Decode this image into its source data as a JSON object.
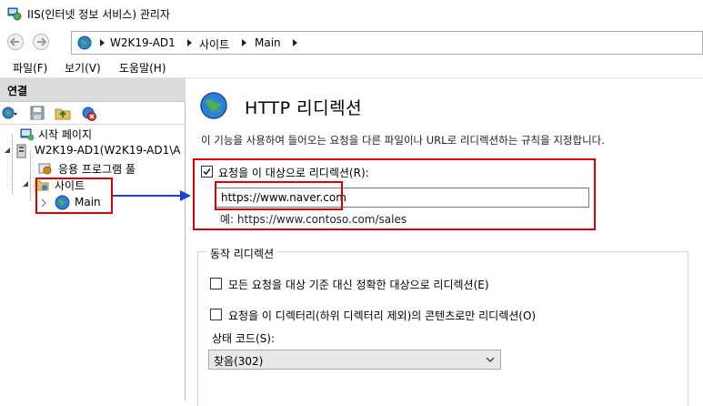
{
  "window": {
    "title": "IIS(인터넷 정보 서비스) 관리자",
    "icon": "iis-manager-icon"
  },
  "address_bar": {
    "crumbs": [
      "W2K19-AD1",
      "사이트",
      "Main"
    ]
  },
  "menu": {
    "items": [
      "파일(F)",
      "보기(V)",
      "도움말(H)"
    ]
  },
  "connections": {
    "header": "연결",
    "tree": [
      {
        "label": "시작 페이지",
        "icon": "start-page-icon"
      },
      {
        "label": "W2K19-AD1(W2K19-AD1\\A",
        "icon": "server-icon"
      },
      {
        "label": "응용 프로그램 풀",
        "icon": "app-pool-icon"
      },
      {
        "label": "사이트",
        "icon": "sites-folder-icon"
      },
      {
        "label": "Main",
        "icon": "globe-icon"
      }
    ]
  },
  "feature": {
    "title": "HTTP 리디렉션",
    "description": "이 기능을 사용하여 들어오는 요청을 다른 파일이나 URL로 리디렉션하는 규칙을 지정합니다.",
    "redirect_checkbox": {
      "label": "요청을 이 대상으로 리디렉션(R):",
      "checked": true
    },
    "target_url": "https://www.naver.com",
    "example": "예: https://www.contoso.com/sales",
    "behavior": {
      "title": "동작 리디렉션",
      "exact_destination": {
        "label": "모든 요청을 대상 기준 대신 정확한 대상으로 리디렉션(E)",
        "checked": false
      },
      "only_this_dir": {
        "label": "요청을 이 디렉터리(하위 디렉터리 제외)의 콘텐츠로만 리디렉션(O)",
        "checked": false
      },
      "status_code_label": "상태 코드(S):",
      "status_code_value": "찾음(302)"
    }
  },
  "annotation_color": "#e00000",
  "arrow_color": "#1e3fd6"
}
